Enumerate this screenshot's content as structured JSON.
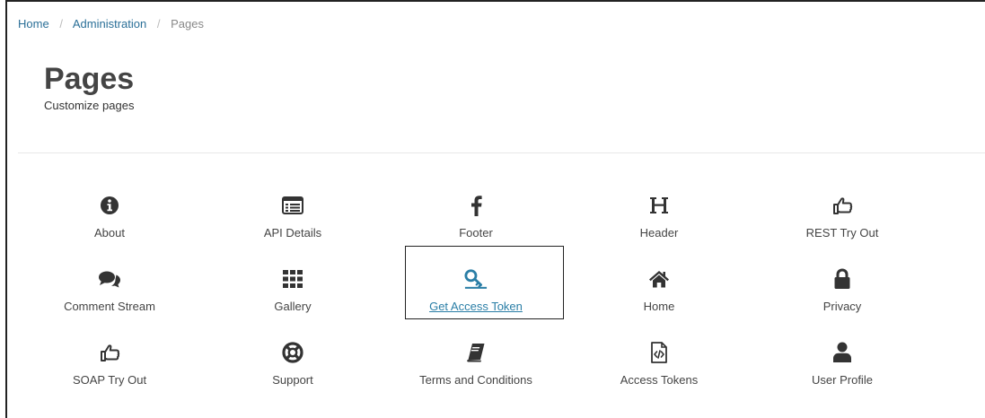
{
  "breadcrumb": {
    "items": [
      "Home",
      "Administration",
      "Pages"
    ],
    "separator": "/"
  },
  "header": {
    "title": "Pages",
    "subtitle": "Customize pages"
  },
  "colors": {
    "icon": "#333333",
    "accent": "#2a7ea6",
    "link": "#2a6f97"
  },
  "tiles": [
    {
      "label": "About",
      "icon": "info-circle-icon"
    },
    {
      "label": "API Details",
      "icon": "list-window-icon"
    },
    {
      "label": "Footer",
      "icon": "facebook-f-icon"
    },
    {
      "label": "Header",
      "icon": "heading-h-icon"
    },
    {
      "label": "REST Try Out",
      "icon": "hand-pointer-icon"
    },
    {
      "label": "Comment Stream",
      "icon": "comments-icon"
    },
    {
      "label": "Gallery",
      "icon": "grid-icon"
    },
    {
      "label": "Get Access Token",
      "icon": "key-icon",
      "active": true
    },
    {
      "label": "Home",
      "icon": "home-icon"
    },
    {
      "label": "Privacy",
      "icon": "lock-icon"
    },
    {
      "label": "SOAP Try Out",
      "icon": "hand-pointer-icon"
    },
    {
      "label": "Support",
      "icon": "life-ring-icon"
    },
    {
      "label": "Terms and Conditions",
      "icon": "book-icon"
    },
    {
      "label": "Access Tokens",
      "icon": "code-file-icon"
    },
    {
      "label": "User Profile",
      "icon": "user-icon"
    }
  ]
}
